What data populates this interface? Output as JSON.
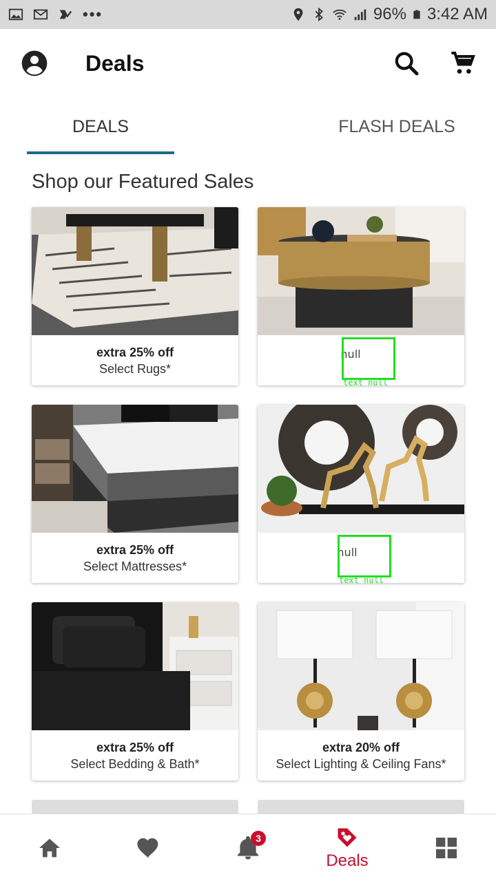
{
  "status_bar": {
    "battery": "96%",
    "time": "3:42 AM",
    "more": "•••"
  },
  "app_bar": {
    "title": "Deals"
  },
  "tabs": [
    {
      "label": "DEALS",
      "selected": true
    },
    {
      "label": "",
      "selected": false
    },
    {
      "label": "FLASH DEALS",
      "selected": false
    }
  ],
  "section_title": "Shop our Featured Sales",
  "cards": [
    {
      "offer": "extra 25% off",
      "desc": "Select Rugs*"
    },
    {
      "null_text": "null",
      "debug_label": "text null"
    },
    {
      "offer": "extra 25% off",
      "desc": "Select Mattresses*"
    },
    {
      "null_text": "null",
      "debug_label": "text null"
    },
    {
      "offer": "extra 25% off",
      "desc": "Select Bedding & Bath*"
    },
    {
      "offer": "extra 20% off",
      "desc": "Select Lighting & Ceiling Fans*"
    }
  ],
  "bottom_nav": {
    "notifications_badge": "3",
    "deals_label": "Deals"
  },
  "colors": {
    "accent_tab": "#1d6a8a",
    "brand_red": "#c8102e",
    "debug_green": "#22dd22"
  }
}
